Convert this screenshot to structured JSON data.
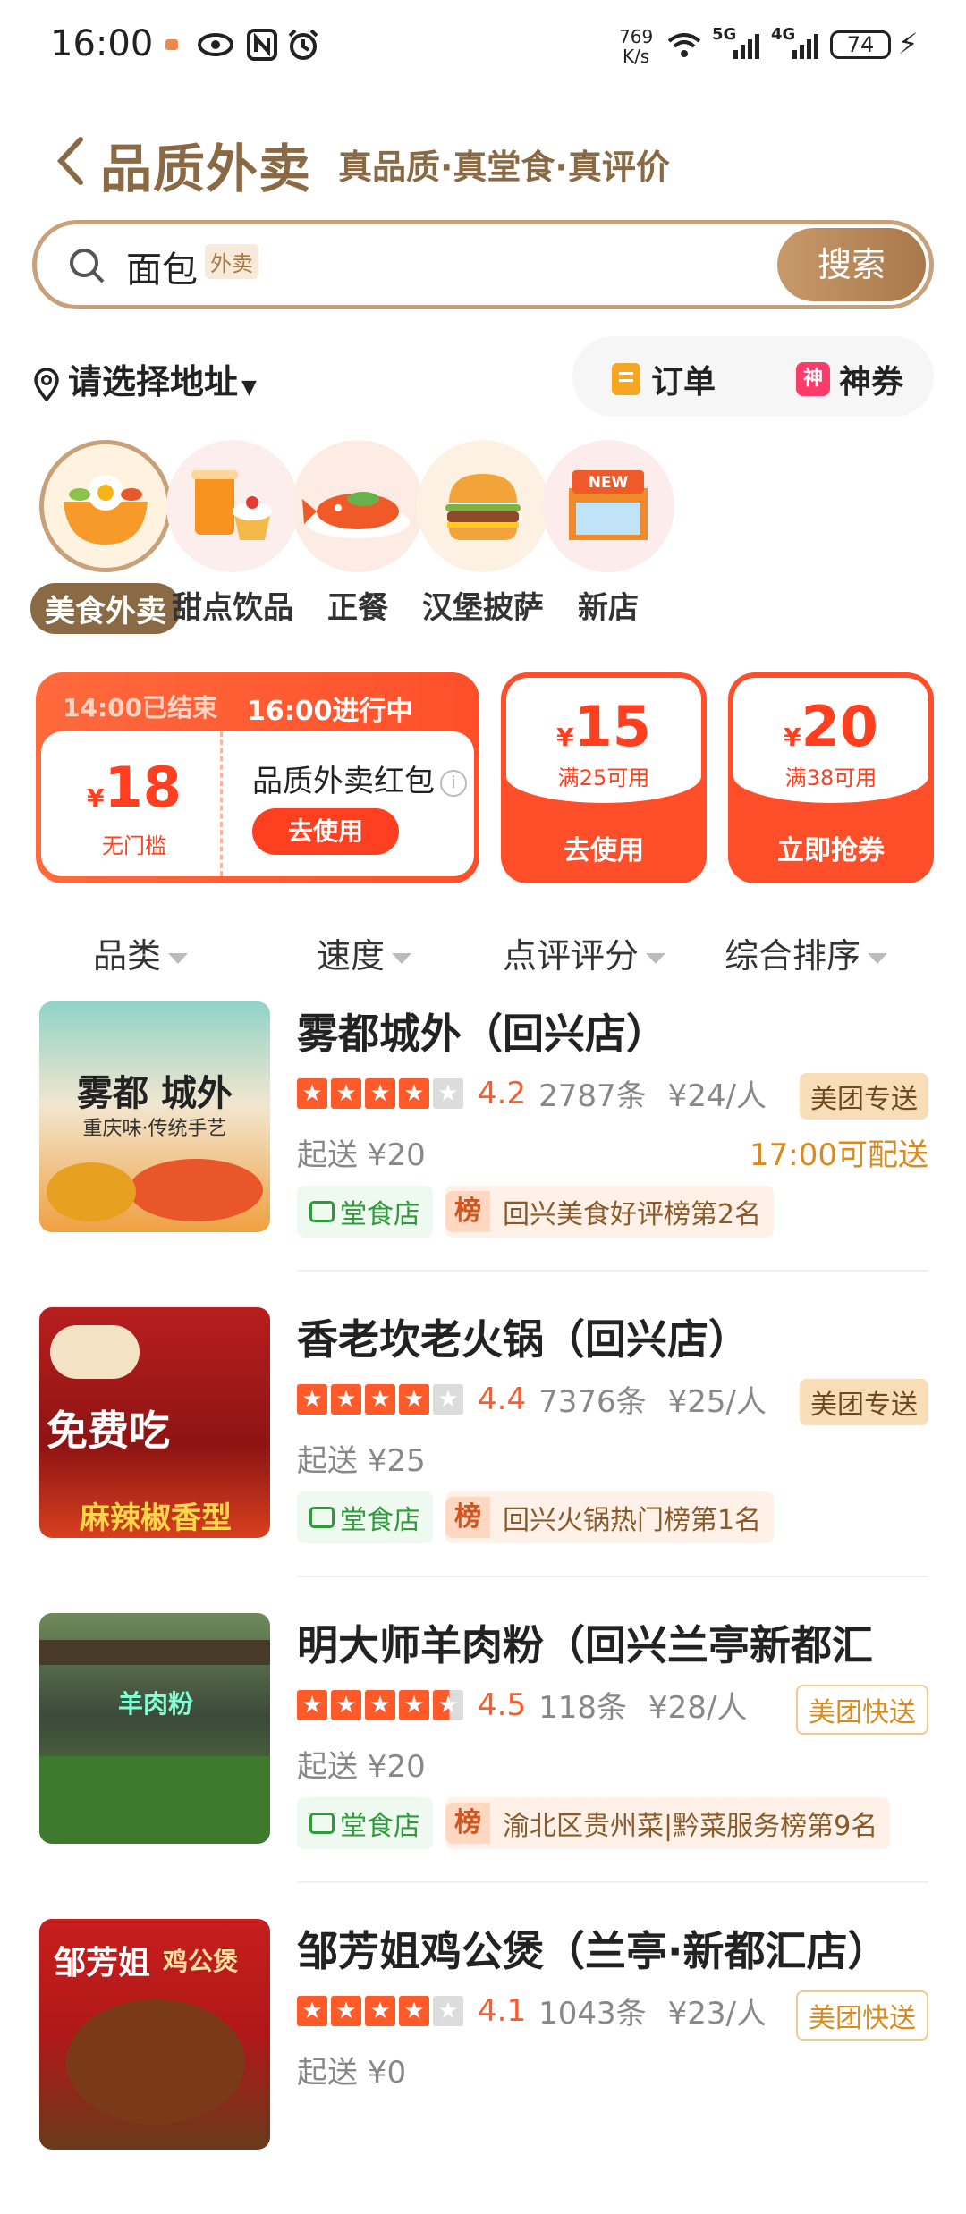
{
  "status": {
    "time": "16:00",
    "speed_top": "769",
    "speed_bottom": "K/s",
    "net1": "5G",
    "net2": "4G",
    "battery": "74"
  },
  "header": {
    "title": "品质外卖",
    "subtitle": "真品质·真堂食·真评价"
  },
  "search": {
    "query": "面包",
    "tag": "外卖",
    "button": "搜索"
  },
  "address": {
    "label": "请选择地址"
  },
  "shortcuts": {
    "orders": "订单",
    "coupons": "神券",
    "coupon_icon": "神"
  },
  "categories": [
    {
      "label": "美食外卖"
    },
    {
      "label": "甜点饮品"
    },
    {
      "label": "正餐"
    },
    {
      "label": "汉堡披萨"
    },
    {
      "label": "新店"
    }
  ],
  "coupon_main": {
    "ended": "14:00已结束",
    "ongoing": "16:00进行中",
    "currency": "¥",
    "amount": "18",
    "condition": "无门槛",
    "name": "品质外卖红包",
    "info": "i",
    "action": "去使用"
  },
  "coupons": [
    {
      "currency": "¥",
      "amount": "15",
      "condition": "满25可用",
      "action": "去使用"
    },
    {
      "currency": "¥",
      "amount": "20",
      "condition": "满38可用",
      "action": "立即抢券"
    }
  ],
  "filters": [
    "品类",
    "速度",
    "点评评分",
    "综合排序"
  ],
  "shops": [
    {
      "name": "雾都城外（回兴店）",
      "score": "4.2",
      "reviews": "2787条",
      "price": "¥24/人",
      "delivery": "美团专送",
      "min": "起送 ¥20",
      "eta": "17:00可配送",
      "tag1": "堂食店",
      "rank_icon": "榜",
      "rank": "回兴美食好评榜第2名",
      "thumb_text1": "雾都 城外",
      "thumb_text2": "重庆味·传统手艺"
    },
    {
      "name": "香老坎老火锅（回兴店）",
      "score": "4.4",
      "reviews": "7376条",
      "price": "¥25/人",
      "delivery": "美团专送",
      "min": "起送 ¥25",
      "eta": "",
      "tag1": "堂食店",
      "rank_icon": "榜",
      "rank": "回兴火锅热门榜第1名",
      "thumb_text1": "免费吃",
      "thumb_text2": "麻辣椒香型"
    },
    {
      "name": "明大师羊肉粉（回兴兰亭新都汇",
      "score": "4.5",
      "reviews": "118条",
      "price": "¥28/人",
      "delivery": "美团快送",
      "min": "起送 ¥20",
      "eta": "",
      "tag1": "堂食店",
      "rank_icon": "榜",
      "rank": "渝北区贵州菜|黔菜服务榜第9名",
      "thumb_text1": "羊肉粉",
      "thumb_text2": ""
    },
    {
      "name": "邹芳姐鸡公煲（兰亭·新都汇店）",
      "score": "4.1",
      "reviews": "1043条",
      "price": "¥23/人",
      "delivery": "美团快送",
      "min": "起送 ¥0",
      "eta": "",
      "tag1": "",
      "rank_icon": "",
      "rank": "",
      "thumb_text1": "邹芳姐",
      "thumb_text2": "鸡公煲"
    }
  ],
  "colors": {
    "brand": "#8a6a45",
    "accent": "#ff4f2a",
    "star": "#ff5a2a"
  }
}
